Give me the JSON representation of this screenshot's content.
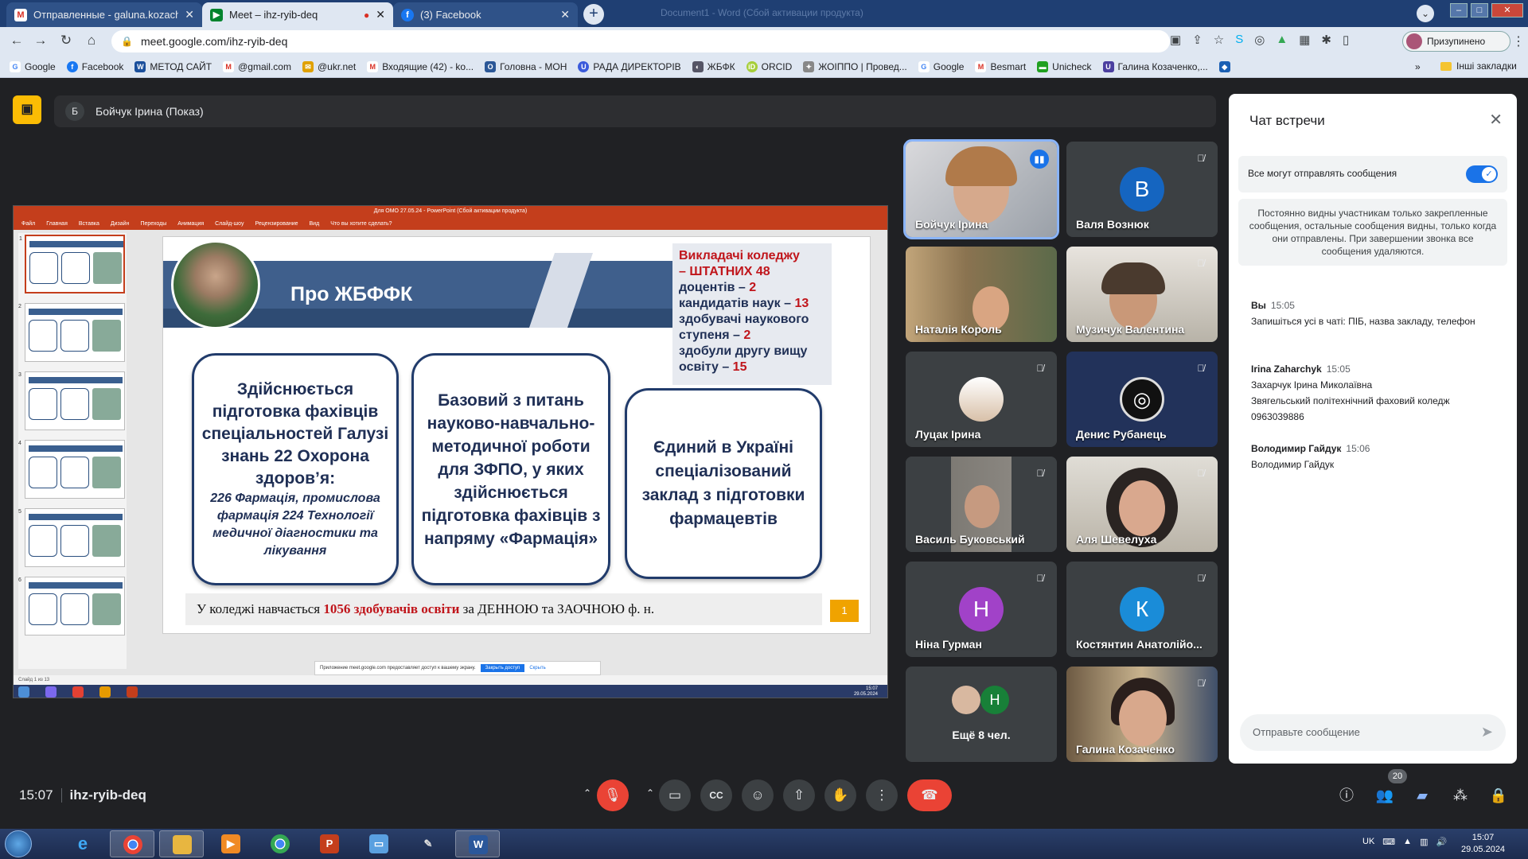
{
  "browser": {
    "tabs": [
      {
        "title": "Отправленные - galuna.kozache",
        "icon": "gmail-icon",
        "color": "#d93025"
      },
      {
        "title": "Meet – ihz-ryib-deq",
        "icon": "meet-icon",
        "color": "#00832d"
      },
      {
        "title": "(3) Facebook",
        "icon": "facebook-icon",
        "color": "#1877f2"
      }
    ],
    "window_title": "Document1 - Word (Сбой активации продукта)",
    "url": "meet.google.com/ihz-ryib-deq",
    "profile_label": "Призупинено",
    "bookmarks": [
      "Google",
      "Facebook",
      "МЕТОД САЙТ",
      "@gmail.com",
      "@ukr.net",
      "Входящие (42) - ko...",
      "Головна - МОН",
      "РАДА ДИРЕКТОРІВ",
      "ЖБФК",
      "ORCID",
      "ЖОІППО | Провед...",
      "Google",
      "Besmart",
      "Unicheck",
      "Галина Козаченко,..."
    ],
    "bookmarks_more": "»",
    "bookmarks_other": "Інші закладки"
  },
  "meet": {
    "presenter_initial": "Б",
    "presenter_label": "Бойчук Ірина (Показ)",
    "clock": "15:07",
    "meeting_code": "ihz-ryib-deq",
    "participants_count": "20"
  },
  "slide": {
    "window_title": "Для ОМО 27.05.24 - PowerPoint (Сбой активации продукта)",
    "ribbon": [
      "Файл",
      "Главная",
      "Вставка",
      "Дизайн",
      "Переходы",
      "Анимация",
      "Слайд-шоу",
      "Рецензирование",
      "Вид",
      "Что вы хотите сделать?"
    ],
    "title": "Про ЖБФФК",
    "teachers": [
      {
        "text": "Викладачі коледжу",
        "red": true
      },
      {
        "text": "– ШТАТНИХ 48",
        "red": true
      },
      {
        "text": "доцентів – ",
        "num": "2"
      },
      {
        "text": "кандидатів наук – ",
        "num": "13"
      },
      {
        "text": "здобувачі наукового",
        "num": ""
      },
      {
        "text": "ступеня – ",
        "num": "2"
      },
      {
        "text": "здобули другу вищу",
        "num": ""
      },
      {
        "text": "освіту – ",
        "num": "15"
      }
    ],
    "box1_main": "Здійснюється підготовка фахівців спеціальностей Галузі знань 22 Охорона здоров’я:",
    "box1_sub": "226 Фармація, промислова фармація 224 Технології медичної діагностики та лікування",
    "box2": "Базовий з питань науково-навчально-методичної роботи для ЗФПО, у яких здійснюється підготовка фахівців з напряму «Фармація»",
    "box3": "Єдиний в Україні спеціалізований заклад з підготовки фармацевтів",
    "bottom_pre": "У коледжі навчається ",
    "bottom_red": "1056 здобувачів освіти",
    "bottom_post": " за ДЕННОЮ та ЗАОЧНОЮ  ф. н.",
    "slide_number": "1",
    "share_notice": "Приложение meet.google.com предоставляет доступ к вашему экрану.",
    "share_stop": "Закрыть доступ",
    "share_hide": "Скрыть",
    "status": "Слайд 1 из 13",
    "mini_clock": "15:07",
    "mini_date": "29.05.2024"
  },
  "participants": [
    {
      "name": "Бойчук Ірина",
      "type": "photo",
      "speaking": true
    },
    {
      "name": "Валя Вознюк",
      "type": "avatar",
      "initial": "В",
      "color": "#1565c0"
    },
    {
      "name": "Наталія Король",
      "type": "photo"
    },
    {
      "name": "Музичук Валентина",
      "type": "photo"
    },
    {
      "name": "Луцак Ірина",
      "type": "avatar-photo"
    },
    {
      "name": "Денис Рубанець",
      "type": "avatar-obs"
    },
    {
      "name": "Василь Буковський",
      "type": "photo"
    },
    {
      "name": "Аля Шевелуха",
      "type": "photo"
    },
    {
      "name": "Ніна Гурман",
      "type": "avatar",
      "initial": "Н",
      "color": "#a142c8"
    },
    {
      "name": "Костянтин Анатолійо...",
      "type": "avatar",
      "initial": "К",
      "color": "#1a8cd8"
    },
    {
      "name": "Ещё 8 чел.",
      "type": "more",
      "initial": "Н"
    },
    {
      "name": "Галина Козаченко",
      "type": "photo"
    }
  ],
  "chat": {
    "title": "Чат встречи",
    "setting_label": "Все могут отправлять сообщения",
    "notice": "Постоянно видны участникам только закрепленные сообщения, остальные сообщения видны, только когда они отправлены. При завершении звонка все сообщения удаляются.",
    "messages": [
      {
        "who": "Вы",
        "time": "15:05",
        "lines": [
          "Запишіться усі в чаті: ПІБ, назва закладу, телефон"
        ]
      },
      {
        "who": "Irina Zaharchyk",
        "time": "15:05",
        "lines": [
          "Захарчук Ірина Миколаївна",
          "Звягельський політехнічний фаховий коледж",
          "0963039886"
        ]
      },
      {
        "who": "Володимир Гайдук",
        "time": "15:06",
        "lines": [
          "Володимир Гайдук"
        ]
      }
    ],
    "input_placeholder": "Отправьте сообщение"
  },
  "taskbar": {
    "lang": "UK",
    "time": "15:07",
    "date": "29.05.2024"
  }
}
